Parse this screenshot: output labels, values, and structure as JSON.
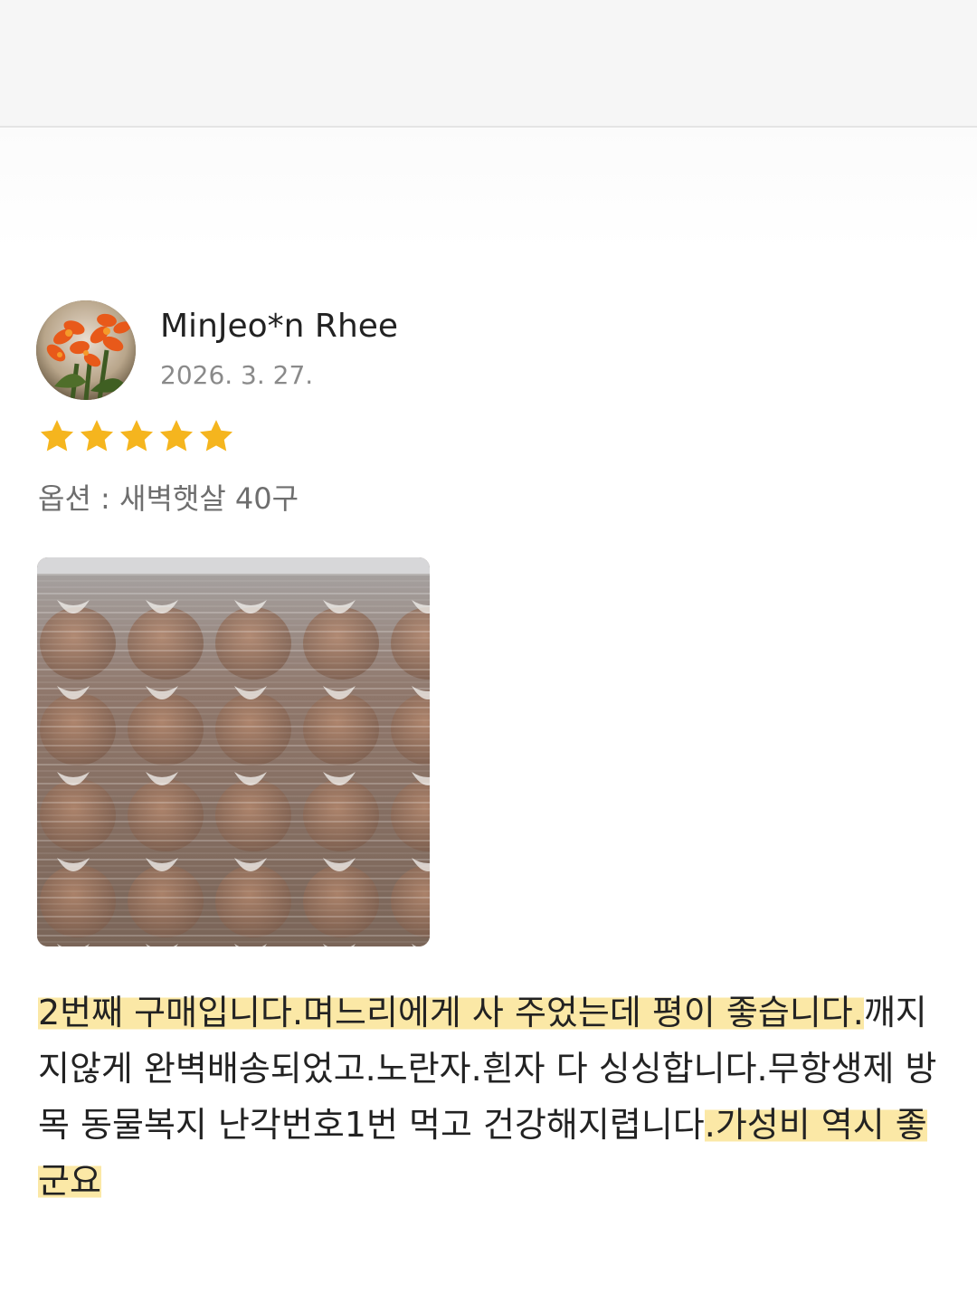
{
  "review": {
    "reviewer_name": "MinJeo*n Rhee",
    "date": "2026. 3. 27.",
    "rating": 5,
    "rating_max": 5,
    "star_color": "#f5b51e",
    "option_text": "옵션 : 새벽햇살 40구",
    "avatar_icon": "orange-flower-photo",
    "photo_icon": "egg-tray-photo",
    "text_segments": [
      {
        "text": "2번째 구매입니다.며느리에게 사 주었는데 평이 좋습니다.",
        "highlighted": true
      },
      {
        "text": "깨지지않게 완벽배송되었고.노란자.흰자 다 싱싱합니다.무항생제 방목 동물복지 난각번호1번 먹고 건강해지렵니다",
        "highlighted": false
      },
      {
        "text": ".가성비 역시 좋군요",
        "highlighted": true
      }
    ],
    "highlight_color": "#fbe8a6"
  }
}
